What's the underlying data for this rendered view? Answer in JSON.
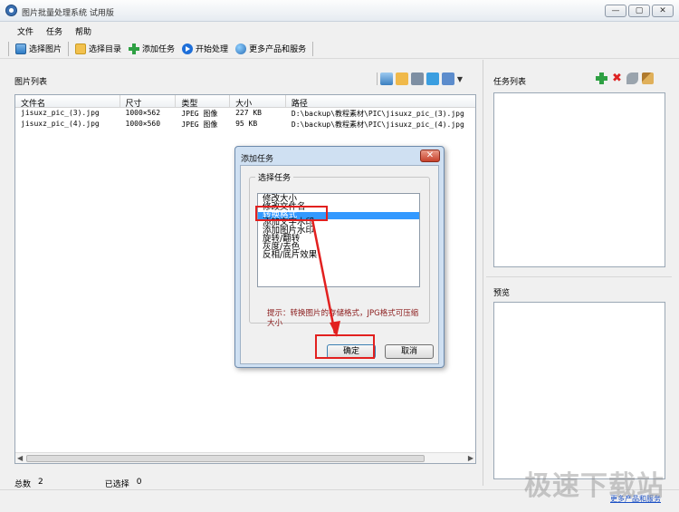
{
  "window": {
    "title": "图片批量处理系统 试用版",
    "buttons": {
      "minimize": "—",
      "restore": "▢",
      "close": "✕"
    }
  },
  "menu": [
    "文件",
    "任务",
    "帮助"
  ],
  "toolbar": {
    "select_image": "选择图片",
    "select_dir": "选择目录",
    "add_task": "添加任务",
    "start_process": "开始处理",
    "more_products": "更多产品和服务"
  },
  "image_list": {
    "title": "图片列表",
    "columns": [
      "文件名",
      "尺寸",
      "类型",
      "大小",
      "路径"
    ],
    "rows": [
      [
        "jisuxz_pic_(3).jpg",
        "1000×562",
        "JPEG 图像",
        "227 KB",
        "D:\\backup\\教程素材\\PIC\\jisuxz_pic_(3).jpg"
      ],
      [
        "jisuxz_pic_(4).jpg",
        "1000×560",
        "JPEG 图像",
        "95 KB",
        "D:\\backup\\教程素材\\PIC\\jisuxz_pic_(4).jpg"
      ]
    ]
  },
  "status": {
    "total_label": "总数",
    "total_value": "2",
    "selected_label": "已选择",
    "selected_value": "0"
  },
  "task_panel": {
    "title": "任务列表"
  },
  "preview_panel": {
    "title": "预览"
  },
  "more_link": "更多产品和服务",
  "watermark": "极速下载站",
  "dialog": {
    "title": "添加任务",
    "close": "✕",
    "group_label": "选择任务",
    "options": [
      "修改大小",
      "修改文件名",
      "转换格式",
      "添加文字水印",
      "添加图片水印",
      "旋转/翻转",
      "灰度/去色",
      "反相/底片效果"
    ],
    "selected_index": 2,
    "hint": "提示：转换图片的存储格式，JPG格式可压缩大小",
    "ok": "确定",
    "cancel": "取消"
  },
  "colors": {
    "highlight": "#e2201f",
    "selection": "#3399ff",
    "hint_text": "#8a1a1a"
  }
}
